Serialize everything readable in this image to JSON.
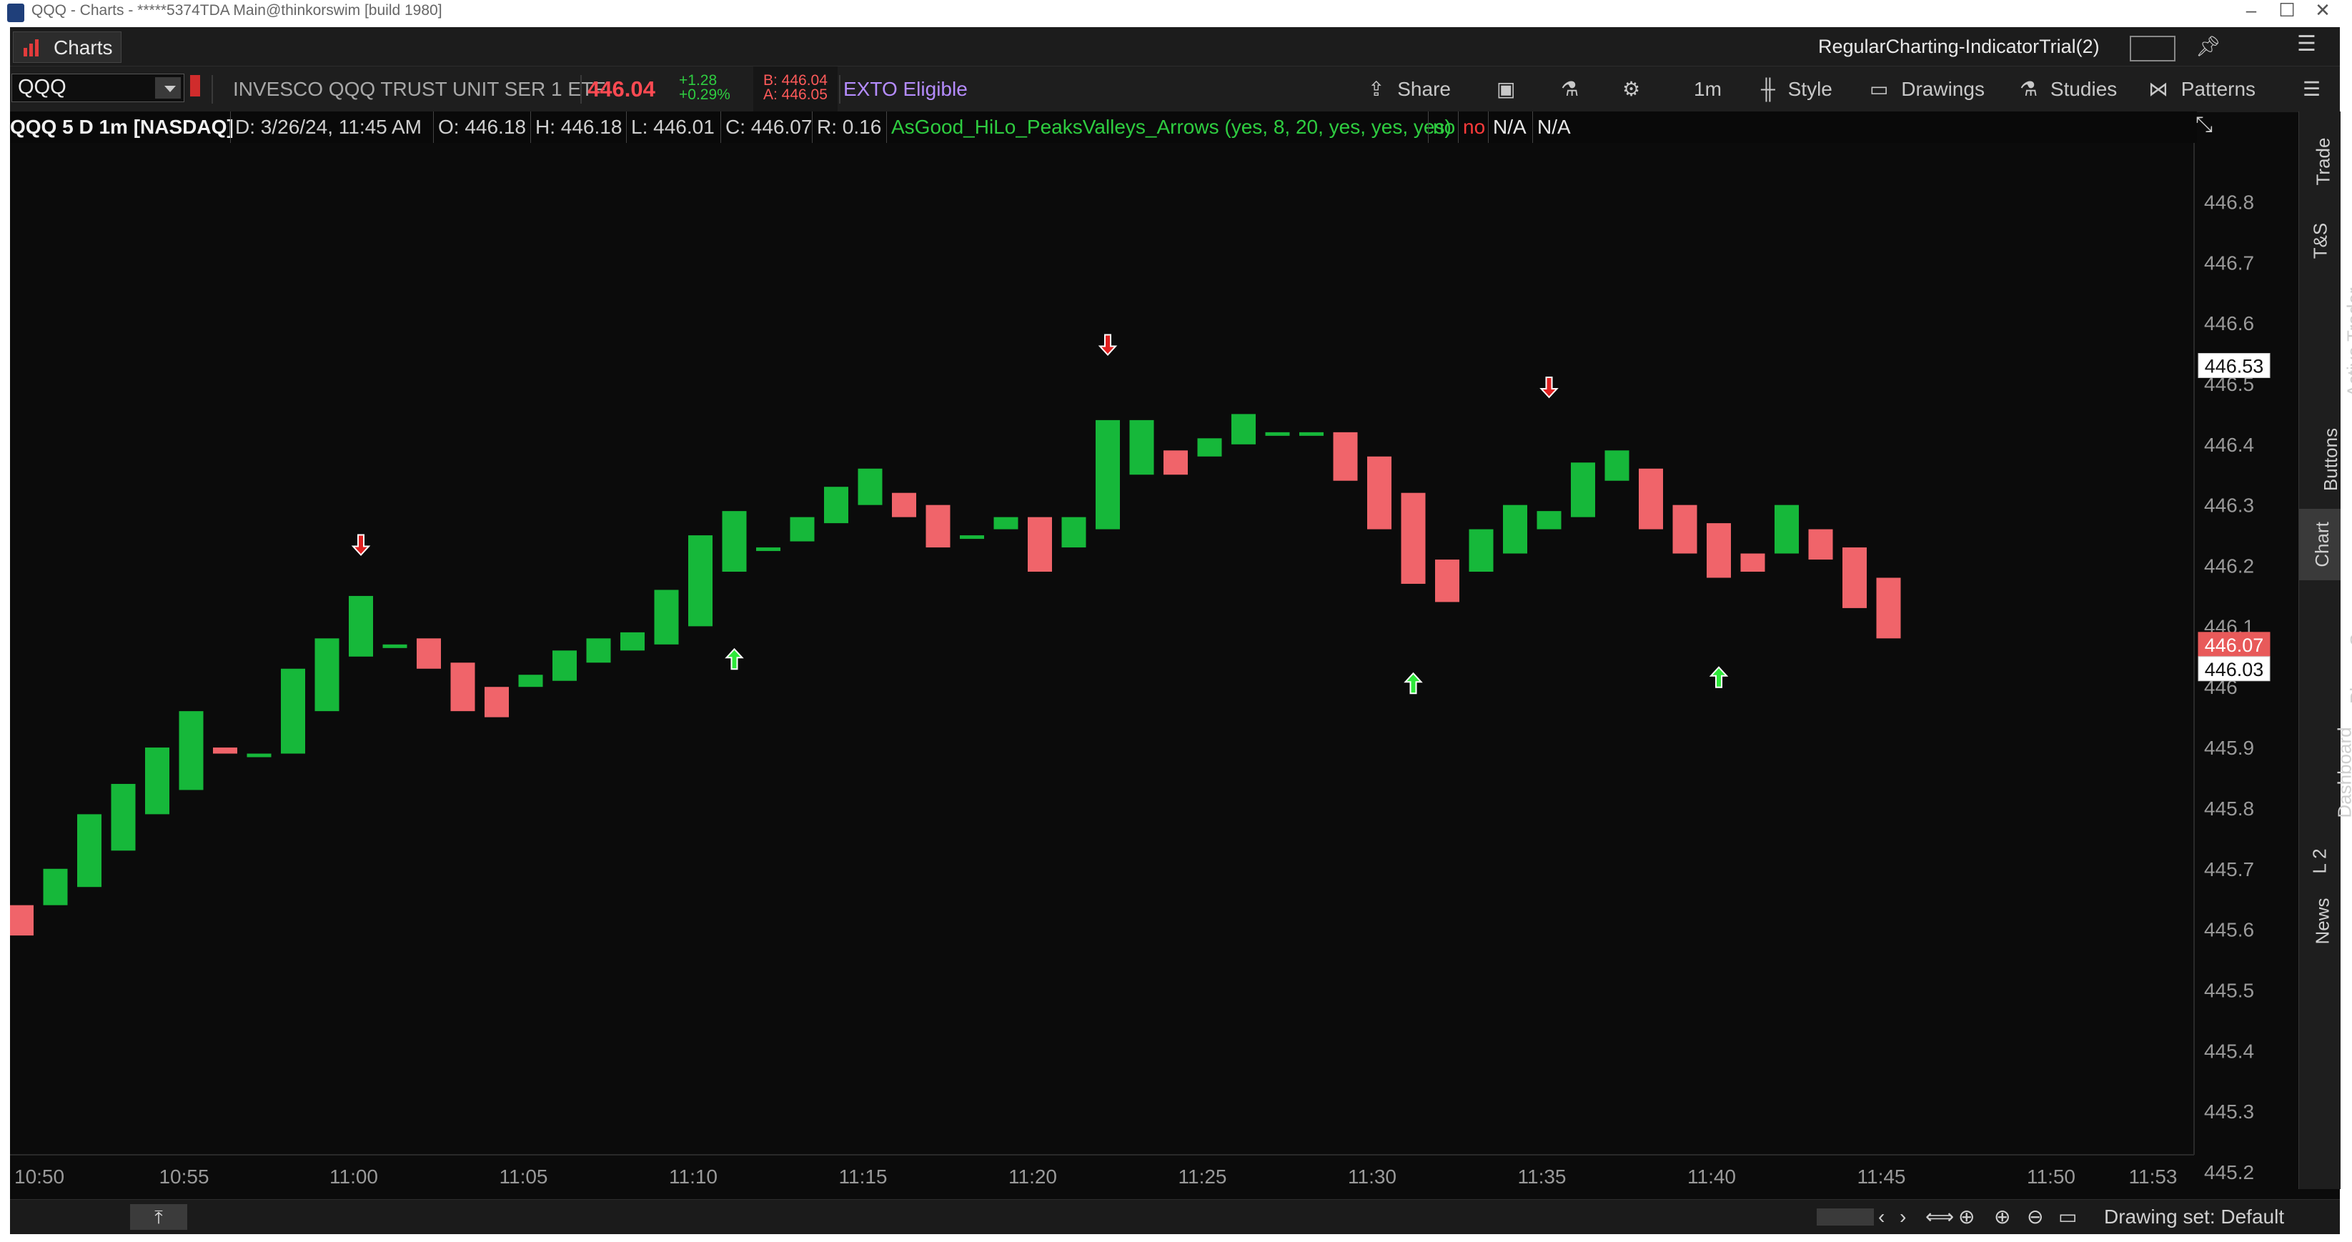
{
  "window": {
    "title": "QQQ - Charts - *****5374TDA Main@thinkorswim [build 1980]"
  },
  "tabrow": {
    "charts_tab": "Charts",
    "workspace_name": "RegularCharting-IndicatorTrial(2)"
  },
  "toolbar": {
    "symbol": "QQQ",
    "description": "INVESCO QQQ TRUST UNIT SER 1 ETF",
    "last_price": "446.04",
    "change": "+1.28",
    "change_pct": "+0.29%",
    "bid": "B: 446.04",
    "ask": "A: 446.05",
    "exto": "EXTO Eligible",
    "share": "Share",
    "timeframe": "1m",
    "style": "Style",
    "drawings": "Drawings",
    "studies": "Studies",
    "patterns": "Patterns"
  },
  "infobar": {
    "symbol_period": "QQQ 5 D 1m [NASDAQ]",
    "date": "D: 3/26/24, 11:45 AM",
    "open": "O: 446.18",
    "high": "H: 446.18",
    "low": "L: 446.01",
    "close": "C: 446.07",
    "range": "R: 0.16",
    "study": "AsGood_HiLo_PeaksValleys_Arrows (yes, 8, 20, yes, yes, yes)",
    "flag1": "no",
    "flag2": "no",
    "na1": "N/A",
    "na2": "N/A"
  },
  "sidebar": {
    "tabs": [
      "Trade",
      "T&S",
      "Active Trader",
      "Buttons",
      "Chart",
      "Phase Scores",
      "Dashboard",
      "L 2",
      "News"
    ],
    "active": "Chart"
  },
  "bottombar": {
    "drawing_set": "Drawing set: Default"
  },
  "chart_data": {
    "type": "candlestick",
    "x_labels": [
      "10:50",
      "10:55",
      "11:00",
      "11:05",
      "11:10",
      "11:15",
      "11:20",
      "11:25",
      "11:30",
      "11:35",
      "11:40",
      "11:45",
      "11:50",
      "11:53"
    ],
    "y_ticks": [
      "446.8",
      "446.7",
      "446.6",
      "446.5",
      "446.4",
      "446.3",
      "446.2",
      "446.1",
      "446",
      "445.9",
      "445.8",
      "445.7",
      "445.6",
      "445.5",
      "445.4",
      "445.3",
      "445.2"
    ],
    "ylim": [
      445.2,
      446.85
    ],
    "price_tags": [
      {
        "value": "446.53",
        "style": "white"
      },
      {
        "value": "446.07",
        "style": "red"
      },
      {
        "value": "446.03",
        "style": "white"
      }
    ],
    "candles_open_close": [
      [
        445.64,
        445.59
      ],
      [
        445.64,
        445.7
      ],
      [
        445.67,
        445.79
      ],
      [
        445.73,
        445.84
      ],
      [
        445.79,
        445.9
      ],
      [
        445.83,
        445.96
      ],
      [
        445.9,
        445.89
      ],
      [
        445.89,
        445.89
      ],
      [
        445.89,
        446.03
      ],
      [
        445.96,
        446.08
      ],
      [
        446.05,
        446.15
      ],
      [
        446.07,
        446.07
      ],
      [
        446.08,
        446.03
      ],
      [
        446.04,
        445.96
      ],
      [
        446.0,
        445.95
      ],
      [
        446.0,
        446.02
      ],
      [
        446.01,
        446.06
      ],
      [
        446.04,
        446.08
      ],
      [
        446.06,
        446.09
      ],
      [
        446.07,
        446.16
      ],
      [
        446.1,
        446.25
      ],
      [
        446.19,
        446.29
      ],
      [
        446.23,
        446.23
      ],
      [
        446.24,
        446.28
      ],
      [
        446.27,
        446.33
      ],
      [
        446.3,
        446.36
      ],
      [
        446.32,
        446.28
      ],
      [
        446.3,
        446.23
      ],
      [
        446.25,
        446.25
      ],
      [
        446.26,
        446.28
      ],
      [
        446.28,
        446.19
      ],
      [
        446.23,
        446.28
      ],
      [
        446.26,
        446.44
      ],
      [
        446.35,
        446.44
      ],
      [
        446.39,
        446.35
      ],
      [
        446.38,
        446.41
      ],
      [
        446.4,
        446.45
      ],
      [
        446.42,
        446.42
      ],
      [
        446.42,
        446.42
      ],
      [
        446.42,
        446.34
      ],
      [
        446.38,
        446.26
      ],
      [
        446.32,
        446.17
      ],
      [
        446.21,
        446.14
      ],
      [
        446.19,
        446.26
      ],
      [
        446.22,
        446.3
      ],
      [
        446.26,
        446.29
      ],
      [
        446.28,
        446.37
      ],
      [
        446.34,
        446.39
      ],
      [
        446.36,
        446.26
      ],
      [
        446.3,
        446.22
      ],
      [
        446.27,
        446.18
      ],
      [
        446.22,
        446.19
      ],
      [
        446.22,
        446.3
      ],
      [
        446.26,
        446.21
      ],
      [
        446.23,
        446.13
      ],
      [
        446.18,
        446.08
      ]
    ],
    "arrows": [
      {
        "bar": 10,
        "dir": "down",
        "price": 446.22
      },
      {
        "bar": 21,
        "dir": "up",
        "price": 446.06
      },
      {
        "bar": 32,
        "dir": "down",
        "price": 446.55
      },
      {
        "bar": 41,
        "dir": "up",
        "price": 446.02
      },
      {
        "bar": 45,
        "dir": "down",
        "price": 446.48
      },
      {
        "bar": 50,
        "dir": "up",
        "price": 446.03
      }
    ]
  },
  "colors": {
    "up": "#16b83a",
    "down": "#f0646a",
    "background": "#0b0b0b",
    "price": "#ff4a52",
    "study": "#2ecc40",
    "exto": "#b58cff"
  }
}
